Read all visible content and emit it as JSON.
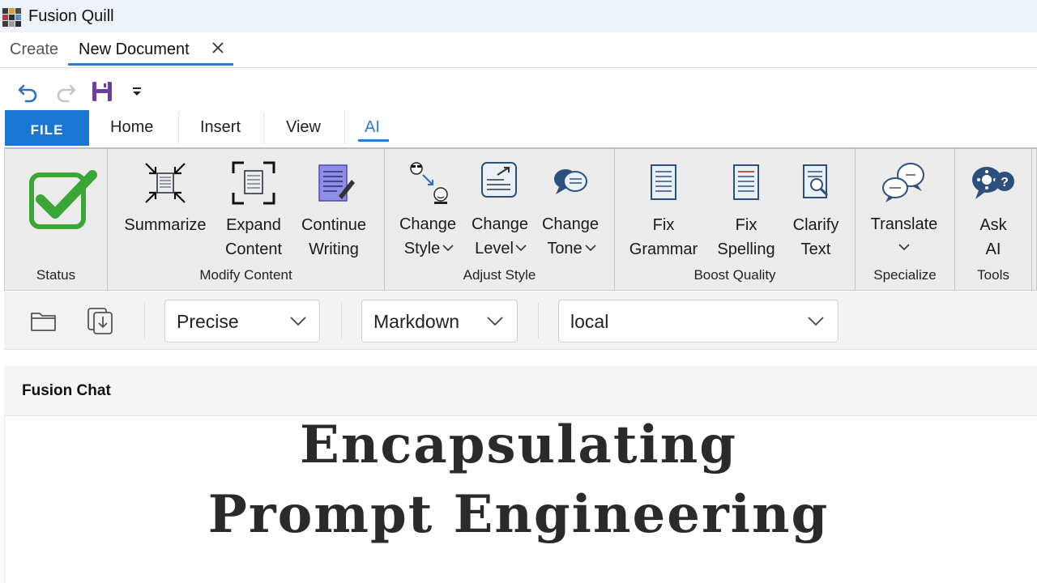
{
  "app": {
    "title": "Fusion Quill"
  },
  "doc_tabs": [
    {
      "label": "Create",
      "active": false
    },
    {
      "label": "New Document",
      "active": true
    }
  ],
  "quick_access": [
    "undo-icon",
    "redo-icon",
    "save-icon",
    "customize-icon"
  ],
  "menu": {
    "file": "FILE",
    "tabs": [
      "Home",
      "Insert",
      "View",
      "AI"
    ],
    "active": "AI"
  },
  "ribbon": {
    "groups": [
      {
        "label": "Status",
        "buttons": [
          {
            "icon": "status-check-icon"
          }
        ]
      },
      {
        "label": "Modify Content",
        "buttons": [
          {
            "line1": "Summarize",
            "line2": ""
          },
          {
            "line1": "Expand",
            "line2": "Content"
          },
          {
            "line1": "Continue",
            "line2": "Writing"
          }
        ]
      },
      {
        "label": "Adjust Style",
        "buttons": [
          {
            "line1": "Change",
            "line2": "Style"
          },
          {
            "line1": "Change",
            "line2": "Level"
          },
          {
            "line1": "Change",
            "line2": "Tone"
          }
        ]
      },
      {
        "label": "Boost Quality",
        "buttons": [
          {
            "line1": "Fix",
            "line2": "Grammar"
          },
          {
            "line1": "Fix",
            "line2": "Spelling"
          },
          {
            "line1": "Clarify",
            "line2": "Text"
          }
        ]
      },
      {
        "label": "Specialize",
        "buttons": [
          {
            "line1": "Translate",
            "line2": ""
          }
        ]
      },
      {
        "label": "Tools",
        "buttons": [
          {
            "line1": "Ask",
            "line2": "AI"
          }
        ]
      }
    ]
  },
  "toolbar": {
    "mode": "Precise",
    "format": "Markdown",
    "model": "local"
  },
  "chat": {
    "title": "Fusion Chat",
    "banner_line1": "Encapsulating",
    "banner_line2": "Prompt Engineering"
  },
  "colors": {
    "accent": "#1976d2",
    "tab_underline": "#2b7bd9",
    "status_green": "#3aa637",
    "save_purple": "#6b3fa0"
  }
}
